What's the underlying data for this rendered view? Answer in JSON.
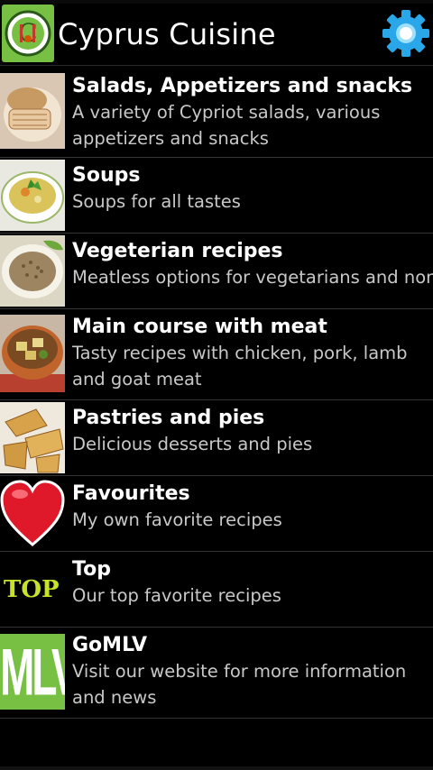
{
  "app": {
    "title": "Cyprus Cuisine",
    "icon": "app-logo-icon",
    "settings_icon": "gear-icon"
  },
  "menu": [
    {
      "title": "Salads, Appetizers and snacks",
      "subtitle": "A variety of Cypriot salads, various appetizers and snacks",
      "icon": "salad-photo"
    },
    {
      "title": "Soups",
      "subtitle": "Soups for all tastes",
      "icon": "soup-photo"
    },
    {
      "title": "Vegeterian recipes",
      "subtitle": "Meatless options for vegetarians and non",
      "icon": "vegetarian-photo"
    },
    {
      "title": "Main course with meat",
      "subtitle": "Tasty recipes with chicken, pork, lamb and goat meat",
      "icon": "meat-dish-photo"
    },
    {
      "title": "Pastries and pies",
      "subtitle": "Delicious desserts and pies",
      "icon": "pastries-photo"
    },
    {
      "title": "Favourites",
      "subtitle": "My own favorite recipes",
      "icon": "heart-icon"
    },
    {
      "title": "Top",
      "subtitle": "Our top favorite recipes",
      "icon": "top-badge",
      "badge_text": "TOP"
    },
    {
      "title": "GoMLV",
      "subtitle": "Visit our website for more information and news",
      "icon": "mlv-logo",
      "badge_text": "MLV"
    }
  ],
  "colors": {
    "accent_green": "#78c043",
    "top_yellow": "#c8e22a",
    "heart_red": "#e0192a",
    "gear_blue": "#2aa7e8"
  }
}
